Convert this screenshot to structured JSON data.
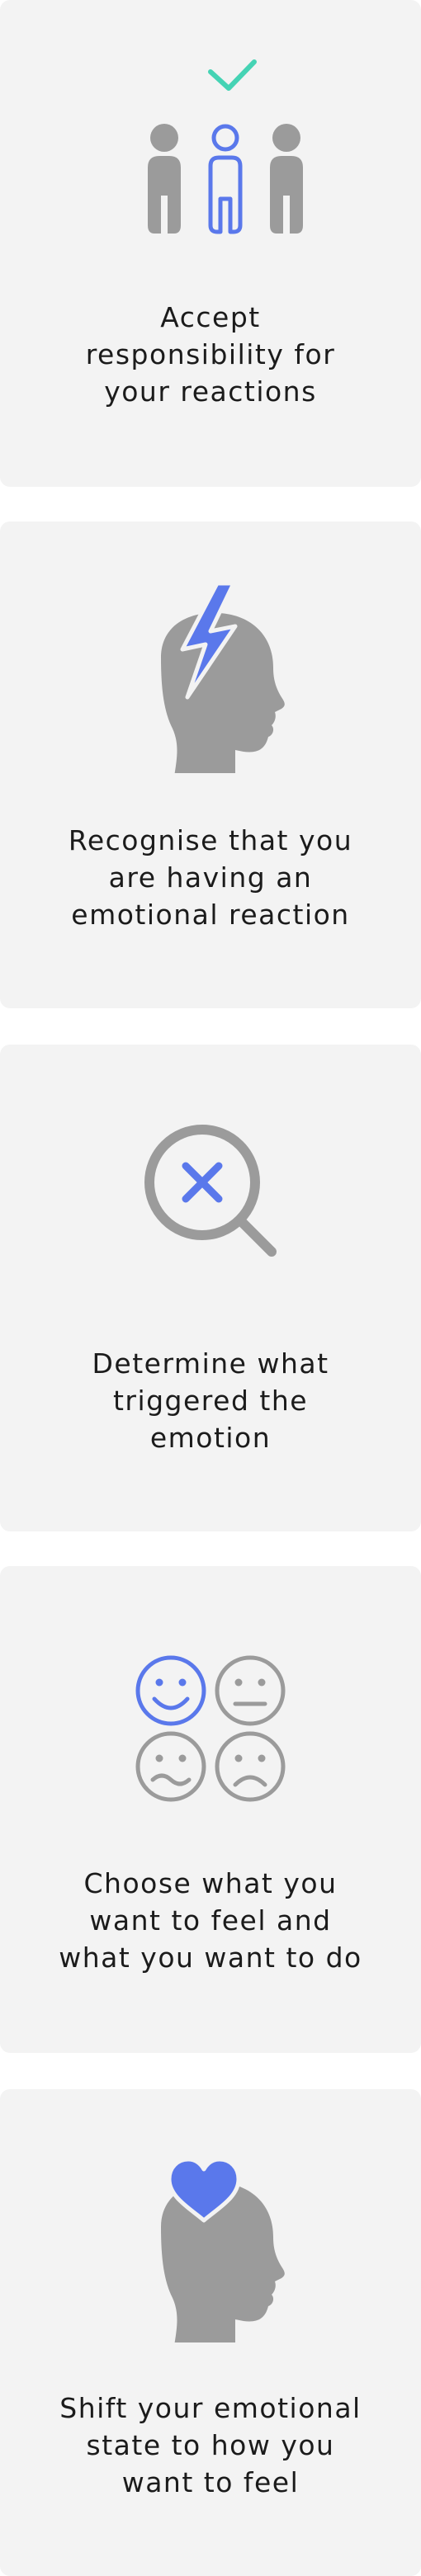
{
  "colors": {
    "card_background": "#f3f3f3",
    "accent_blue": "#5a78eb",
    "accent_teal": "#45d3b4",
    "icon_gray": "#9b9b9b",
    "text": "#1b1b1b"
  },
  "steps": [
    {
      "icon": "people-with-checkmark-icon",
      "caption_lines": [
        "Accept",
        "responsibility for",
        "your reactions"
      ]
    },
    {
      "icon": "head-with-lightning-icon",
      "caption_lines": [
        "Recognise that you",
        "are having an",
        "emotional reaction"
      ]
    },
    {
      "icon": "magnifier-with-x-icon",
      "caption_lines": [
        "Determine what",
        "triggered the",
        "emotion"
      ]
    },
    {
      "icon": "emotion-faces-icon",
      "caption_lines": [
        "Choose what you",
        "want to feel and",
        "what you want to do"
      ]
    },
    {
      "icon": "head-with-heart-icon",
      "caption_lines": [
        "Shift your emotional",
        "state to how you",
        "want to feel"
      ]
    }
  ]
}
